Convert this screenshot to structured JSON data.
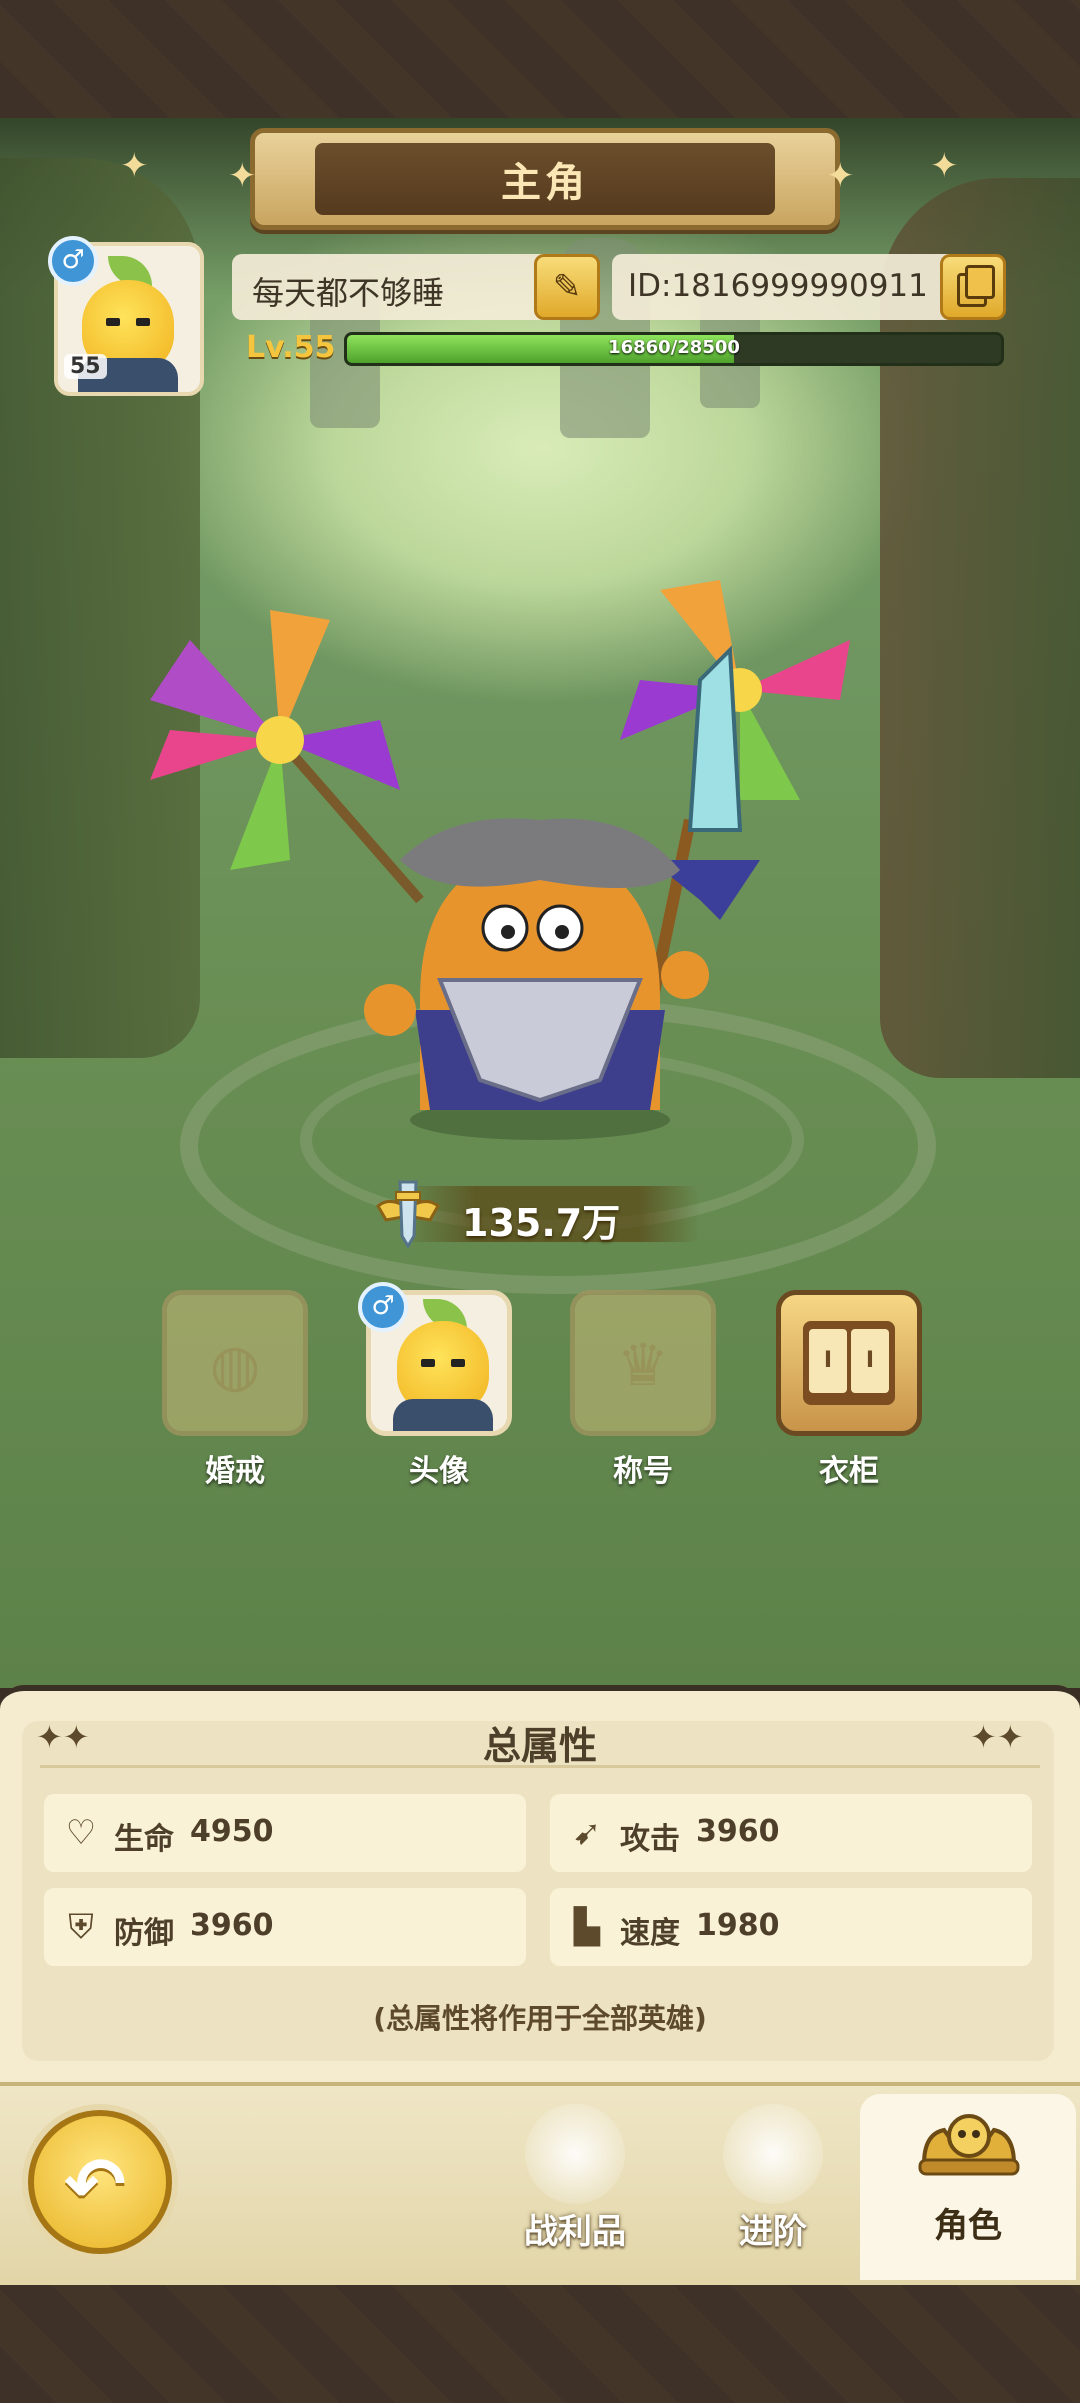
{
  "header": {
    "title": "主角"
  },
  "player": {
    "level_badge": "55",
    "gender": "♂",
    "name": "每天都不够睡",
    "id": "ID:1816999990911",
    "level_label": "Lv.55",
    "exp_text": "16860/28500",
    "exp_progress": 0.5916
  },
  "power": {
    "value": "135.7万"
  },
  "features": [
    {
      "label": "婚戒",
      "locked": true
    },
    {
      "label": "头像",
      "locked": false
    },
    {
      "label": "称号",
      "locked": true
    },
    {
      "label": "衣柜",
      "locked": false
    }
  ],
  "attributes": {
    "title": "总属性",
    "stats": [
      {
        "label": "生命",
        "value": "4950",
        "icon": "heart-icon"
      },
      {
        "label": "攻击",
        "value": "3960",
        "icon": "claw-icon"
      },
      {
        "label": "防御",
        "value": "3960",
        "icon": "shield-icon"
      },
      {
        "label": "速度",
        "value": "1980",
        "icon": "boot-icon"
      }
    ],
    "note": "(总属性将作用于全部英雄)"
  },
  "nav": {
    "tabs": [
      {
        "label": "战利品",
        "active": false
      },
      {
        "label": "进阶",
        "active": false
      },
      {
        "label": "角色",
        "active": true
      }
    ]
  },
  "colors": {
    "accent_gold": "#f4c53d",
    "exp_green": "#6cc847",
    "panel_bg": "#f5ecd0"
  }
}
